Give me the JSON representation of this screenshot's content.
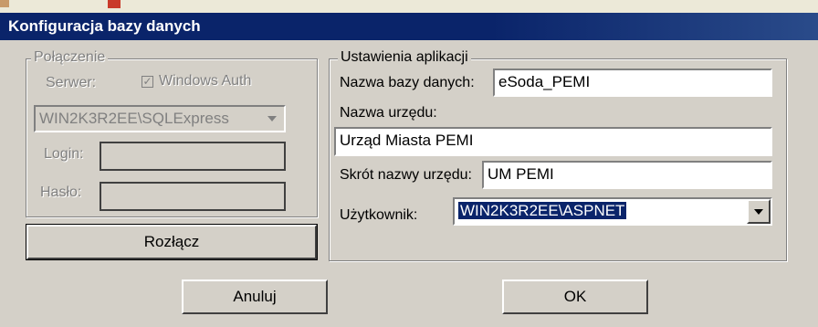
{
  "window": {
    "title": "Konfiguracja bazy danych"
  },
  "connection": {
    "group_label": "Połączenie",
    "server_label": "Serwer:",
    "windows_auth_label": "Windows Auth",
    "windows_auth_checked": true,
    "server_value": "WIN2K3R2EE\\SQLExpress",
    "login_label": "Login:",
    "login_value": "",
    "password_label": "Hasło:",
    "password_value": "",
    "disconnect_label": "Rozłącz"
  },
  "app_settings": {
    "group_label": "Ustawienia aplikacji",
    "db_name_label": "Nazwa bazy danych:",
    "db_name_value": "eSoda_PEMI",
    "office_name_label": "Nazwa urzędu:",
    "office_name_value": "Urząd Miasta PEMI",
    "office_short_label": "Skrót nazwy urzędu:",
    "office_short_value": "UM PEMI",
    "user_label": "Użytkownik:",
    "user_value": "WIN2K3R2EE\\ASPNET"
  },
  "buttons": {
    "cancel_label": "Anuluj",
    "ok_label": "OK"
  }
}
